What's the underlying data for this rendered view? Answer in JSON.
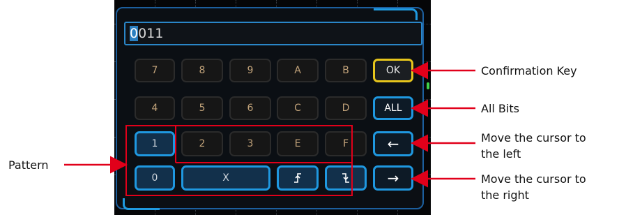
{
  "display": {
    "cursor_char": "0",
    "rest": "011"
  },
  "keys": {
    "row1": [
      "7",
      "8",
      "9",
      "A",
      "B"
    ],
    "row2": [
      "4",
      "5",
      "6",
      "C",
      "D"
    ],
    "row3": [
      "1",
      "2",
      "3",
      "E",
      "F"
    ],
    "row4": [
      "0",
      "X"
    ],
    "ok": "OK",
    "all": "ALL",
    "left_arrow": "←",
    "right_arrow": "→",
    "rising_edge_icon": "⭜",
    "falling_edge_icon": "⭝"
  },
  "callouts": {
    "confirmation": "Confirmation Key",
    "all_bits": "All Bits",
    "move_left_1": "Move the cursor to",
    "move_left_2": "the left",
    "move_right_1": "Move the cursor to",
    "move_right_2": "the right",
    "pattern": "Pattern"
  },
  "colors": {
    "callout_red": "#e1001a",
    "key_blue": "#1f98e0",
    "ok_yellow": "#e6c51c"
  }
}
